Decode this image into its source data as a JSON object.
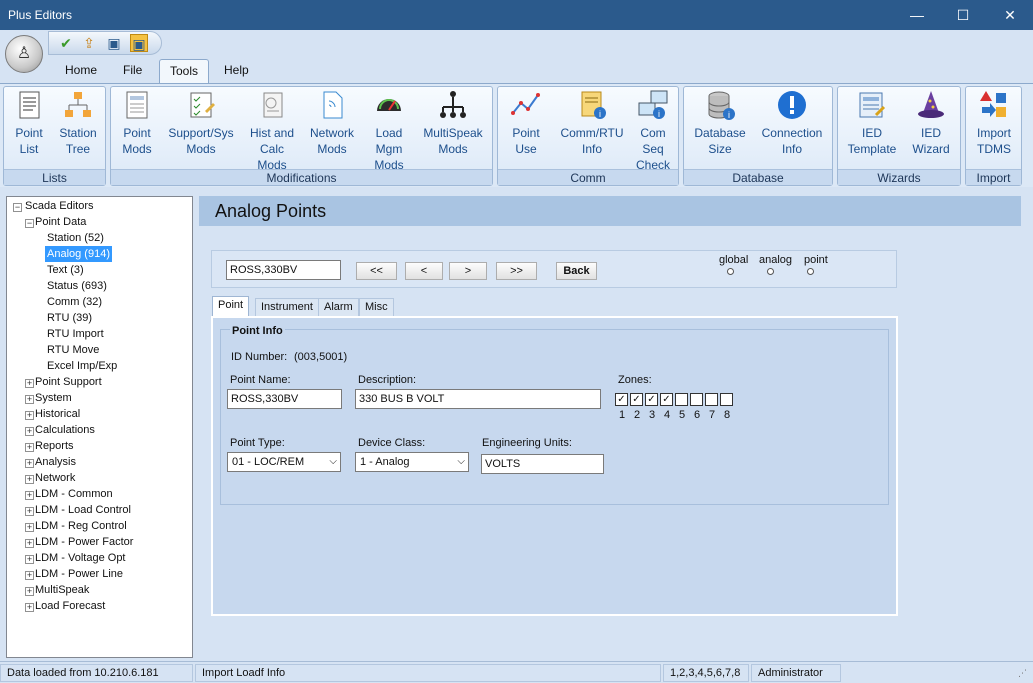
{
  "window": {
    "title": "Plus Editors",
    "minimize": "—",
    "maximize": "☐",
    "close": "✕"
  },
  "ribbon_tabs": [
    "Home",
    "File",
    "Tools",
    "Help"
  ],
  "active_tab": "Tools",
  "ribbon": {
    "groups": [
      {
        "label": "Lists",
        "buttons": [
          {
            "l1": "Point",
            "l2": "List",
            "icon": "document-list-icon"
          },
          {
            "l1": "Station",
            "l2": "Tree",
            "icon": "org-tree-icon"
          }
        ]
      },
      {
        "label": "Modifications",
        "buttons": [
          {
            "l1": "Point",
            "l2": "Mods",
            "icon": "point-mods-icon"
          },
          {
            "l1": "Support/Sys",
            "l2": "Mods",
            "icon": "checklist-icon"
          },
          {
            "l1": "Hist and",
            "l2": "Calc",
            "l3": "Mods",
            "icon": "calc-icon"
          },
          {
            "l1": "Network",
            "l2": "Mods",
            "icon": "network-page-icon"
          },
          {
            "l1": "Load",
            "l2": "Mgm",
            "l3": "Mods",
            "icon": "gauge-icon"
          },
          {
            "l1": "MultiSpeak",
            "l2": "Mods",
            "icon": "hierarchy-icon"
          }
        ]
      },
      {
        "label": "Comm",
        "buttons": [
          {
            "l1": "Point",
            "l2": "Use",
            "icon": "line-graph-icon"
          },
          {
            "l1": "Comm/RTU",
            "l2": "Info",
            "icon": "info-document-icon"
          },
          {
            "l1": "Com",
            "l2": "Seq",
            "l3": "Check",
            "icon": "computers-icon"
          }
        ]
      },
      {
        "label": "Database",
        "buttons": [
          {
            "l1": "Database",
            "l2": "Size",
            "icon": "database-icon"
          },
          {
            "l1": "Connection",
            "l2": "Info",
            "icon": "exclamation-icon"
          }
        ]
      },
      {
        "label": "Wizards",
        "buttons": [
          {
            "l1": "IED",
            "l2": "Template",
            "icon": "template-icon"
          },
          {
            "l1": "IED",
            "l2": "Wizard",
            "icon": "wizard-hat-icon"
          }
        ]
      },
      {
        "label": "Import",
        "buttons": [
          {
            "l1": "Import",
            "l2": "TDMS",
            "icon": "import-shapes-icon"
          }
        ]
      }
    ]
  },
  "tree": {
    "root": "Scada Editors",
    "point_data": "Point Data",
    "point_data_children": [
      "Station  (52)",
      "Analog  (914)",
      "Text  (3)",
      "Status  (693)",
      "Comm  (32)",
      "RTU  (39)",
      "RTU Import",
      "RTU Move",
      "Excel Imp/Exp"
    ],
    "selected": "Analog  (914)",
    "other_nodes": [
      "Point Support",
      "System",
      "Historical",
      "Calculations",
      "Reports",
      "Analysis",
      "Network",
      "LDM - Common",
      "LDM - Load Control",
      "LDM - Reg Control",
      "LDM - Power Factor",
      "LDM - Voltage Opt",
      "LDM - Power Line",
      "MultiSpeak",
      "Load Forecast"
    ]
  },
  "main": {
    "header": "Analog Points",
    "nav": {
      "current": "ROSS,330BV",
      "first": "<<",
      "prev": "<",
      "next": ">",
      "last": ">>",
      "back": "Back"
    },
    "scope": {
      "global": "global",
      "analog": "analog",
      "point": "point"
    },
    "point_tabs": [
      "Point",
      "Instrument",
      "Alarm",
      "Misc"
    ],
    "active_point_tab": "Point",
    "point_info": {
      "group_title": "Point Info",
      "id_label": "ID Number:",
      "id_value": "(003,5001)",
      "name_label": "Point Name:",
      "name_value": "ROSS,330BV",
      "desc_label": "Description:",
      "desc_value": "330 BUS B VOLT",
      "zones_label": "Zones:",
      "zones": [
        {
          "n": "1",
          "checked": true
        },
        {
          "n": "2",
          "checked": true
        },
        {
          "n": "3",
          "checked": true
        },
        {
          "n": "4",
          "checked": true
        },
        {
          "n": "5",
          "checked": false
        },
        {
          "n": "6",
          "checked": false
        },
        {
          "n": "7",
          "checked": false
        },
        {
          "n": "8",
          "checked": false
        }
      ],
      "type_label": "Point Type:",
      "type_value": "01 - LOC/REM",
      "class_label": "Device Class:",
      "class_value": "1 - Analog",
      "units_label": "Engineering Units:",
      "units_value": "VOLTS"
    }
  },
  "status": {
    "loaded": "Data loaded from 10.210.6.181",
    "import": "Import Loadf Info",
    "zones": "1,2,3,4,5,6,7,8",
    "user": "Administrator"
  }
}
